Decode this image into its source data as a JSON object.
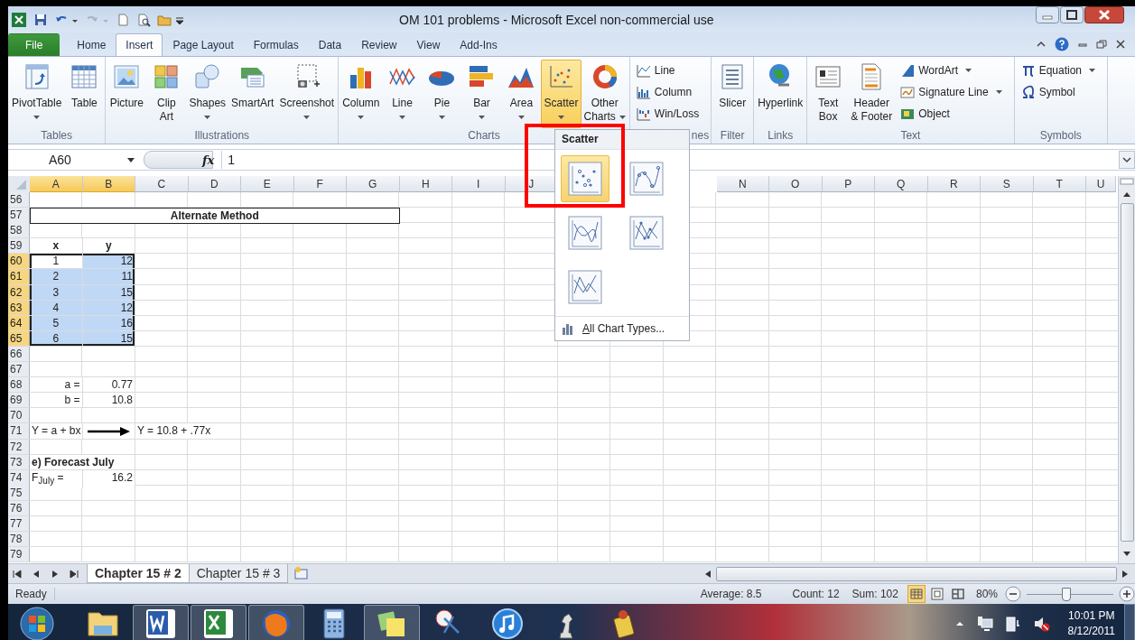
{
  "window": {
    "title": "OM 101 problems  -  Microsoft Excel non-commercial use"
  },
  "quick_access": [
    {
      "disabled": false
    },
    {
      "disabled": true
    }
  ],
  "tabs": [
    {
      "label": "File",
      "kind": "file",
      "selected": false
    },
    {
      "label": "Home",
      "kind": "tab",
      "selected": false
    },
    {
      "label": "Insert",
      "kind": "tab",
      "selected": true
    },
    {
      "label": "Page Layout",
      "kind": "tab",
      "selected": false
    },
    {
      "label": "Formulas",
      "kind": "tab",
      "selected": false
    },
    {
      "label": "Data",
      "kind": "tab",
      "selected": false
    },
    {
      "label": "Review",
      "kind": "tab",
      "selected": false
    },
    {
      "label": "View",
      "kind": "tab",
      "selected": false
    },
    {
      "label": "Add-Ins",
      "kind": "tab",
      "selected": false
    }
  ],
  "ribbon": {
    "groups": [
      {
        "label": "Tables",
        "items": [
          {
            "kind": "large",
            "label": "PivotTable",
            "dropdown": true
          },
          {
            "kind": "large",
            "label": "Table",
            "dropdown": false
          }
        ]
      },
      {
        "label": "Illustrations",
        "items": [
          {
            "kind": "large",
            "label": "Picture",
            "dropdown": false
          },
          {
            "kind": "large",
            "label": "Clip\nArt",
            "dropdown": false
          },
          {
            "kind": "large",
            "label": "Shapes",
            "dropdown": true
          },
          {
            "kind": "large",
            "label": "SmartArt",
            "dropdown": false
          },
          {
            "kind": "large",
            "label": "Screenshot",
            "dropdown": true
          }
        ]
      },
      {
        "label": "Charts",
        "items": [
          {
            "kind": "large",
            "label": "Column",
            "dropdown": true,
            "open": false
          },
          {
            "kind": "large",
            "label": "Line",
            "dropdown": true,
            "open": false
          },
          {
            "kind": "large",
            "label": "Pie",
            "dropdown": true,
            "open": false
          },
          {
            "kind": "large",
            "label": "Bar",
            "dropdown": true,
            "open": false
          },
          {
            "kind": "large",
            "label": "Area",
            "dropdown": true,
            "open": false
          },
          {
            "kind": "large",
            "label": "Scatter",
            "dropdown": true,
            "open": true
          },
          {
            "kind": "large-inline",
            "label": "Other\nCharts",
            "dropdown": true,
            "open": false
          }
        ]
      },
      {
        "label": "nes",
        "label_cut": true,
        "items": [
          {
            "kind": "small",
            "label": "Line",
            "dropdown": false
          },
          {
            "kind": "small",
            "label": "Column",
            "dropdown": false
          },
          {
            "kind": "small",
            "label": "Win/Loss",
            "dropdown": false
          }
        ]
      },
      {
        "label": "Filter",
        "items": [
          {
            "kind": "large",
            "label": "Slicer",
            "dropdown": false
          }
        ]
      },
      {
        "label": "Links",
        "items": [
          {
            "kind": "large",
            "label": "Hyperlink",
            "dropdown": false
          }
        ]
      },
      {
        "label": "Text",
        "items": [
          {
            "kind": "large",
            "label": "Text\nBox",
            "dropdown": false
          },
          {
            "kind": "large",
            "label": "Header\n& Footer",
            "dropdown": false
          },
          {
            "kind": "small",
            "label": "WordArt",
            "dropdown": true
          },
          {
            "kind": "small",
            "label": "Signature Line",
            "dropdown": true
          },
          {
            "kind": "small",
            "label": "Object",
            "dropdown": false
          }
        ]
      },
      {
        "label": "Symbols",
        "items": [
          {
            "kind": "small",
            "label": "Equation",
            "dropdown": true
          },
          {
            "kind": "small",
            "label": "Symbol",
            "dropdown": false
          }
        ]
      }
    ]
  },
  "formula_bar": {
    "name_box": "A60",
    "function_label": "fx",
    "value": "1"
  },
  "columns": [
    {
      "label": "A",
      "selected": true
    },
    {
      "label": "B",
      "selected": true
    },
    {
      "label": "C",
      "selected": false
    },
    {
      "label": "D",
      "selected": false
    },
    {
      "label": "E",
      "selected": false
    },
    {
      "label": "F",
      "selected": false
    },
    {
      "label": "G",
      "selected": false
    },
    {
      "label": "H",
      "selected": false
    },
    {
      "label": "I",
      "selected": false
    },
    {
      "label": "J",
      "selected": false
    },
    null,
    null,
    null,
    {
      "label": "N",
      "selected": false
    },
    {
      "label": "O",
      "selected": false
    },
    {
      "label": "P",
      "selected": false
    },
    {
      "label": "Q",
      "selected": false
    },
    {
      "label": "R",
      "selected": false
    },
    {
      "label": "S",
      "selected": false
    },
    {
      "label": "T",
      "selected": false
    },
    {
      "label": "U",
      "selected": false
    }
  ],
  "rows": [
    {
      "number": "56",
      "selected": false
    },
    {
      "number": "57",
      "selected": false,
      "cells": {
        "A": {
          "text": "Alternate Method",
          "bold": true,
          "centered": true,
          "boxed": true
        },
        "G": {
          "merge_end": true
        }
      }
    },
    {
      "number": "58",
      "selected": false
    },
    {
      "number": "59",
      "selected": false,
      "cells": {
        "A": {
          "text": "x",
          "bold": true,
          "centered": true
        },
        "B": {
          "text": "y",
          "bold": true,
          "centered": true
        }
      }
    },
    {
      "number": "60",
      "selected": true,
      "cells": {
        "A": {
          "text": "1",
          "centered": true,
          "selected": true,
          "active": true
        },
        "B": {
          "text": "12",
          "align_right": true,
          "selected": true,
          "active": false
        }
      }
    },
    {
      "number": "61",
      "selected": true,
      "cells": {
        "A": {
          "text": "2",
          "centered": true,
          "selected": true,
          "active": false
        },
        "B": {
          "text": "11",
          "align_right": true,
          "selected": true,
          "active": false
        }
      }
    },
    {
      "number": "62",
      "selected": true,
      "cells": {
        "A": {
          "text": "3",
          "centered": true,
          "selected": true,
          "active": false
        },
        "B": {
          "text": "15",
          "align_right": true,
          "selected": true,
          "active": false
        }
      }
    },
    {
      "number": "63",
      "selected": true,
      "cells": {
        "A": {
          "text": "4",
          "centered": true,
          "selected": true,
          "active": false
        },
        "B": {
          "text": "12",
          "align_right": true,
          "selected": true,
          "active": false
        }
      }
    },
    {
      "number": "64",
      "selected": true,
      "cells": {
        "A": {
          "text": "5",
          "centered": true,
          "selected": true,
          "active": false
        },
        "B": {
          "text": "16",
          "align_right": true,
          "selected": true,
          "active": false
        }
      }
    },
    {
      "number": "65",
      "selected": true,
      "cells": {
        "A": {
          "text": "6",
          "centered": true,
          "selected": true,
          "active": false
        },
        "B": {
          "text": "15",
          "align_right": true,
          "selected": true,
          "active": false
        }
      }
    },
    {
      "number": "66",
      "selected": false
    },
    {
      "number": "67",
      "selected": false
    },
    {
      "number": "68",
      "selected": false,
      "cells": {
        "A": {
          "text": "a =",
          "align_right": true
        },
        "B": {
          "text": "0.77",
          "align_right": true
        }
      }
    },
    {
      "number": "69",
      "selected": false,
      "cells": {
        "A": {
          "text": "b =",
          "align_right": true
        },
        "B": {
          "text": "10.8",
          "align_right": true
        }
      }
    },
    {
      "number": "70",
      "selected": false
    },
    {
      "number": "71",
      "selected": false,
      "cells": {
        "A": {
          "text": "Y = a + bx"
        },
        "B": {
          "kind": "arrow"
        },
        "C": {
          "text": "Y = 10.8 + .77x"
        },
        "D": {
          "merge_end": true
        }
      }
    },
    {
      "number": "72",
      "selected": false
    },
    {
      "number": "73",
      "selected": false,
      "cells": {
        "A": {
          "text": "e) Forecast July",
          "bold": true
        },
        "B": {
          "merge_end": true
        }
      }
    },
    {
      "number": "74",
      "selected": false,
      "cells": {
        "A": {
          "text": "F$_{July}$ ="
        },
        "B": {
          "text": "16.2",
          "align_right": true
        }
      }
    },
    {
      "number": "75",
      "selected": false
    },
    {
      "number": "76",
      "selected": false
    },
    {
      "number": "77",
      "selected": false
    },
    {
      "number": "78",
      "selected": false
    },
    {
      "number": "79",
      "selected": false
    }
  ],
  "menu": {
    "title": "Scatter",
    "options": [
      {
        "selected": true
      },
      {
        "selected": false
      },
      {
        "selected": false
      },
      {
        "selected": false
      },
      {
        "selected": false
      }
    ],
    "footer": "All Chart Types..."
  },
  "sheet_tabs": [
    {
      "label": "Chapter 15 # 2",
      "selected": true
    },
    {
      "label": "Chapter 15 # 3",
      "selected": false
    }
  ],
  "status_bar": {
    "mode": "Ready",
    "average": "Average: 8.5",
    "count": "Count: 12",
    "sum": "Sum: 102",
    "views": [
      {
        "selected": true
      },
      {
        "selected": false
      },
      {
        "selected": false
      }
    ],
    "zoom": "80%",
    "zoom_slider": {
      "level": 0.45
    }
  },
  "taskbar": {
    "apps": [
      {
        "active": false
      },
      {
        "active": true
      },
      {
        "active": true
      },
      {
        "active": true
      },
      {
        "active": false
      },
      {
        "active": true
      },
      {
        "active": false
      },
      {
        "active": false
      },
      {
        "active": false
      },
      {
        "active": false
      }
    ],
    "time": "10:01 PM",
    "date": "8/12/2011"
  }
}
